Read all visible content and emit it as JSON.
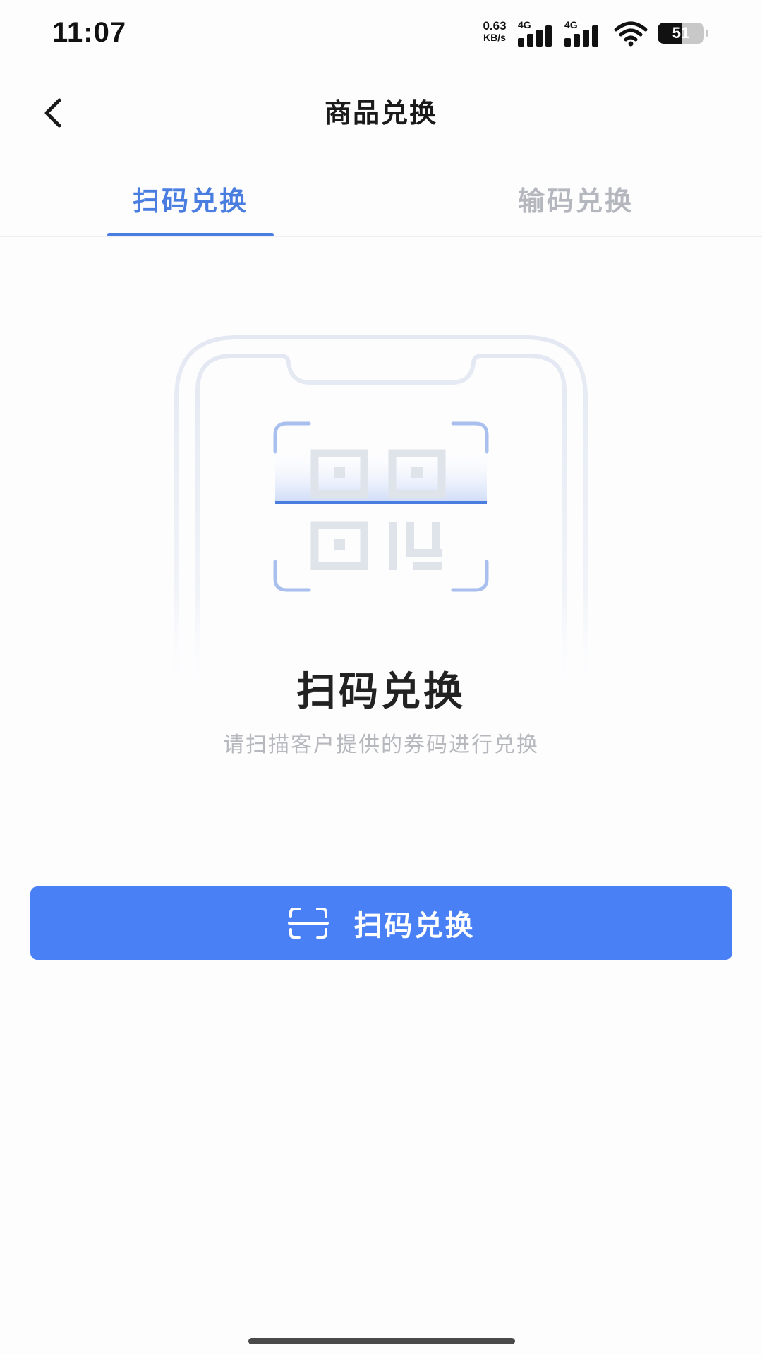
{
  "status_bar": {
    "time": "11:07",
    "net_speed_value": "0.63",
    "net_speed_unit": "KB/s",
    "sim1_label": "4G",
    "sim2_label": "4G",
    "battery_level": "51",
    "battery_fraction": 0.51
  },
  "nav": {
    "title": "商品兑换"
  },
  "tabs": [
    {
      "label": "扫码兑换",
      "active": true
    },
    {
      "label": "输码兑换",
      "active": false
    }
  ],
  "hero": {
    "title": "扫码兑换",
    "subtitle": "请扫描客户提供的券码进行兑换"
  },
  "primary_button": {
    "label": "扫码兑换",
    "icon": "scan-icon"
  },
  "colors": {
    "accent": "#4a7de0",
    "button": "#4a80f5",
    "tab_inactive": "#b4b7bd",
    "subtitle": "#b6b8bd"
  },
  "icons": {
    "back": "chevron-left-icon",
    "wifi": "wifi-icon",
    "battery": "battery-icon",
    "signal": "signal-bars-icon",
    "qr": "qr-code-icon"
  }
}
